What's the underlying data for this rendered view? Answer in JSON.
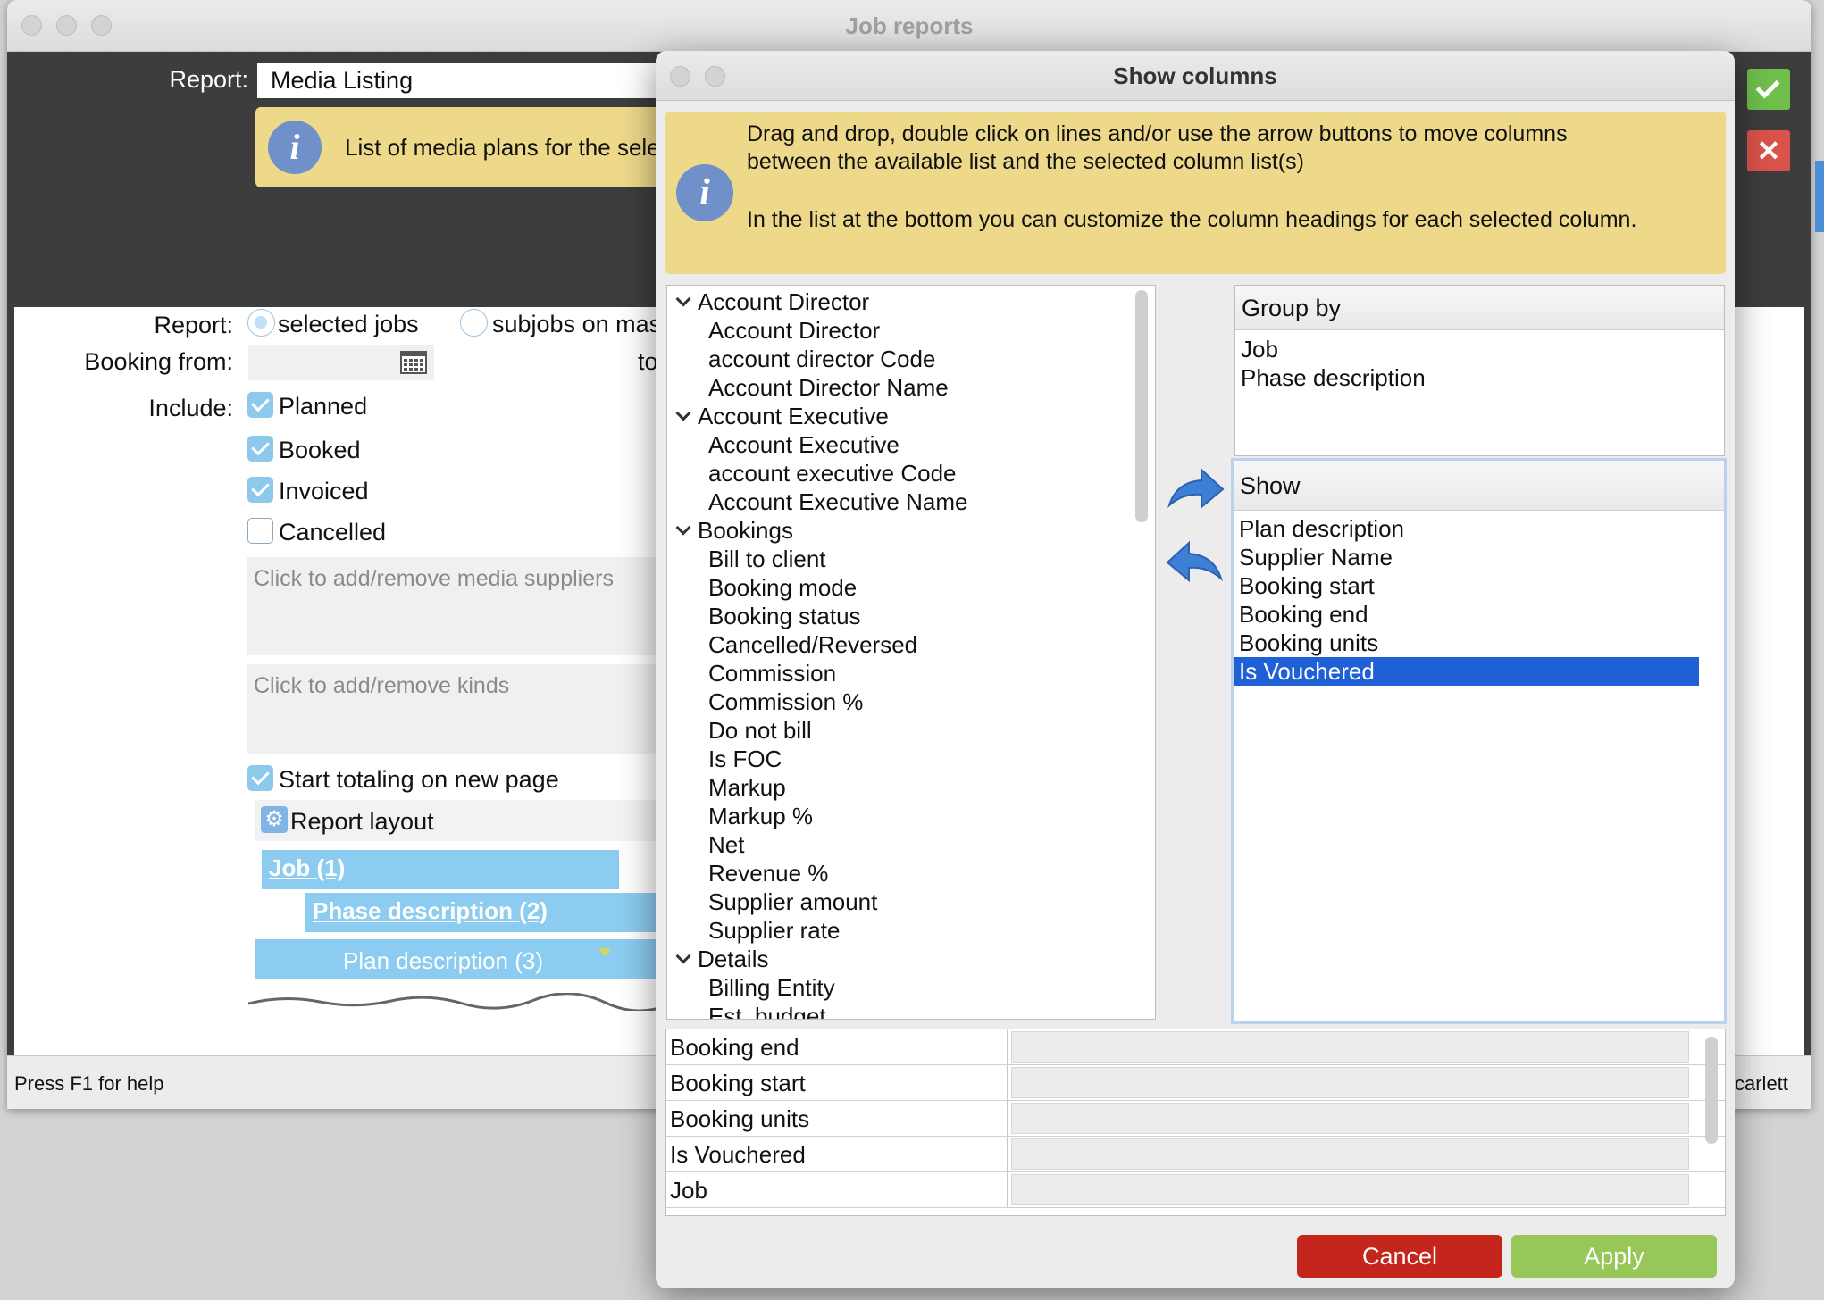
{
  "main_window": {
    "title": "Job reports",
    "report_label": "Report:",
    "report_value": "Media Listing",
    "info_text": "List of media plans for the sele",
    "scope_label": "Report:",
    "radio_selected_jobs": "selected jobs",
    "radio_subjobs": "subjobs on mas",
    "booking_from_label": "Booking from:",
    "to_label": "to",
    "include_label": "Include:",
    "include_options": [
      {
        "label": "Planned",
        "checked": true
      },
      {
        "label": "Booked",
        "checked": true
      },
      {
        "label": "Invoiced",
        "checked": true
      },
      {
        "label": "Cancelled",
        "checked": false
      }
    ],
    "suppliers_placeholder": "Click to add/remove media suppliers",
    "kinds_placeholder": "Click to add/remove kinds",
    "start_totaling_label": "Start totaling on new page",
    "start_totaling_checked": true,
    "report_layout_label": "Report layout",
    "layout_levels": [
      "Job (1)",
      "Phase description (2)",
      "Plan description (3)"
    ],
    "status_bar": "Press F1 for help",
    "status_user": "carlett"
  },
  "dialog": {
    "title": "Show columns",
    "info_line1": "Drag and drop, double click on lines and/or use the arrow buttons to move columns",
    "info_line2": "between the available list and the selected column list(s)",
    "info_line3": "In the list at the bottom you can customize the column headings for each selected column.",
    "available_tree": [
      {
        "type": "group",
        "label": "Account Director"
      },
      {
        "type": "item",
        "label": "Account Director"
      },
      {
        "type": "item",
        "label": "account director Code"
      },
      {
        "type": "item",
        "label": "Account Director Name"
      },
      {
        "type": "group",
        "label": "Account Executive"
      },
      {
        "type": "item",
        "label": "Account Executive"
      },
      {
        "type": "item",
        "label": "account executive Code"
      },
      {
        "type": "item",
        "label": "Account Executive Name"
      },
      {
        "type": "group",
        "label": "Bookings"
      },
      {
        "type": "item",
        "label": "Bill to client"
      },
      {
        "type": "item",
        "label": "Booking mode"
      },
      {
        "type": "item",
        "label": "Booking status"
      },
      {
        "type": "item",
        "label": "Cancelled/Reversed"
      },
      {
        "type": "item",
        "label": "Commission"
      },
      {
        "type": "item",
        "label": "Commission %"
      },
      {
        "type": "item",
        "label": "Do not bill"
      },
      {
        "type": "item",
        "label": "Is FOC"
      },
      {
        "type": "item",
        "label": "Markup"
      },
      {
        "type": "item",
        "label": "Markup %"
      },
      {
        "type": "item",
        "label": "Net"
      },
      {
        "type": "item",
        "label": "Revenue %"
      },
      {
        "type": "item",
        "label": "Supplier amount"
      },
      {
        "type": "item",
        "label": "Supplier rate"
      },
      {
        "type": "group",
        "label": "Details"
      },
      {
        "type": "item",
        "label": "Billing Entity"
      },
      {
        "type": "item",
        "label": "Est. budget"
      }
    ],
    "group_by_header": "Group by",
    "group_by_items": [
      "Job",
      "Phase description"
    ],
    "show_header": "Show",
    "show_items": [
      {
        "label": "Plan description",
        "selected": false
      },
      {
        "label": "Supplier Name",
        "selected": false
      },
      {
        "label": "Booking start",
        "selected": false
      },
      {
        "label": "Booking end",
        "selected": false
      },
      {
        "label": "Booking units",
        "selected": false
      },
      {
        "label": "Is Vouchered",
        "selected": true
      }
    ],
    "heading_rows": [
      "Booking end",
      "Booking start",
      "Booking units",
      "Is Vouchered",
      "Job"
    ],
    "cancel_label": "Cancel",
    "apply_label": "Apply"
  },
  "colors": {
    "info_bg": "#eed98a",
    "selection": "#2060d6",
    "cancel": "#c4261b",
    "apply": "#96c758",
    "confirm": "#6fbf4c",
    "close": "#d9534a",
    "layout_level": "#8cccf0"
  }
}
